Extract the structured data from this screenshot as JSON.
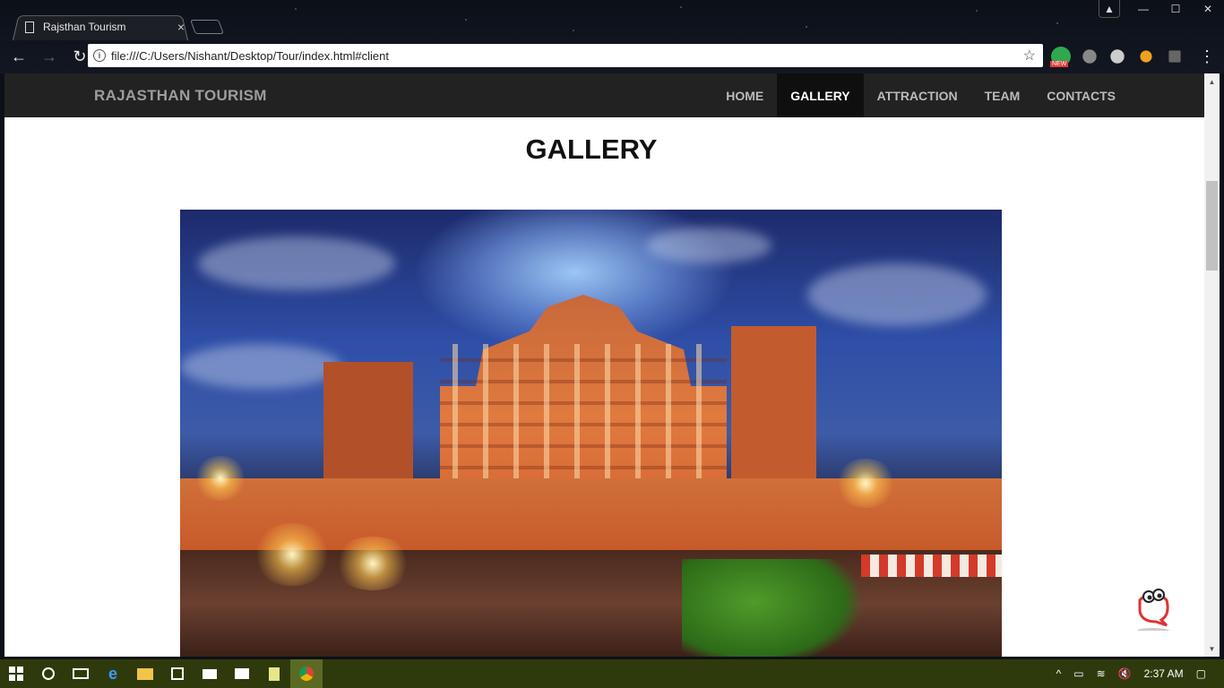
{
  "browser": {
    "tab_title": "Rajsthan Tourism",
    "tab_close": "×",
    "url": "file:///C:/Users/Nishant/Desktop/Tour/index.html#client",
    "info_icon": "i",
    "star_icon": "☆",
    "back_icon": "←",
    "forward_icon": "→",
    "reload_icon": "↻",
    "menu_icon": "⋮",
    "window_minimize": "—",
    "window_maximize": "☐",
    "window_close": "✕",
    "ext_badge": "NEW"
  },
  "site": {
    "brand": "RAJASTHAN TOURISM",
    "nav": [
      {
        "label": "HOME"
      },
      {
        "label": "GALLERY",
        "active": true
      },
      {
        "label": "ATTRACTION"
      },
      {
        "label": "TEAM"
      },
      {
        "label": "CONTACTS"
      }
    ],
    "heading": "GALLERY"
  },
  "taskbar": {
    "time": "2:37 AM",
    "accent": "#2f3a0c"
  }
}
